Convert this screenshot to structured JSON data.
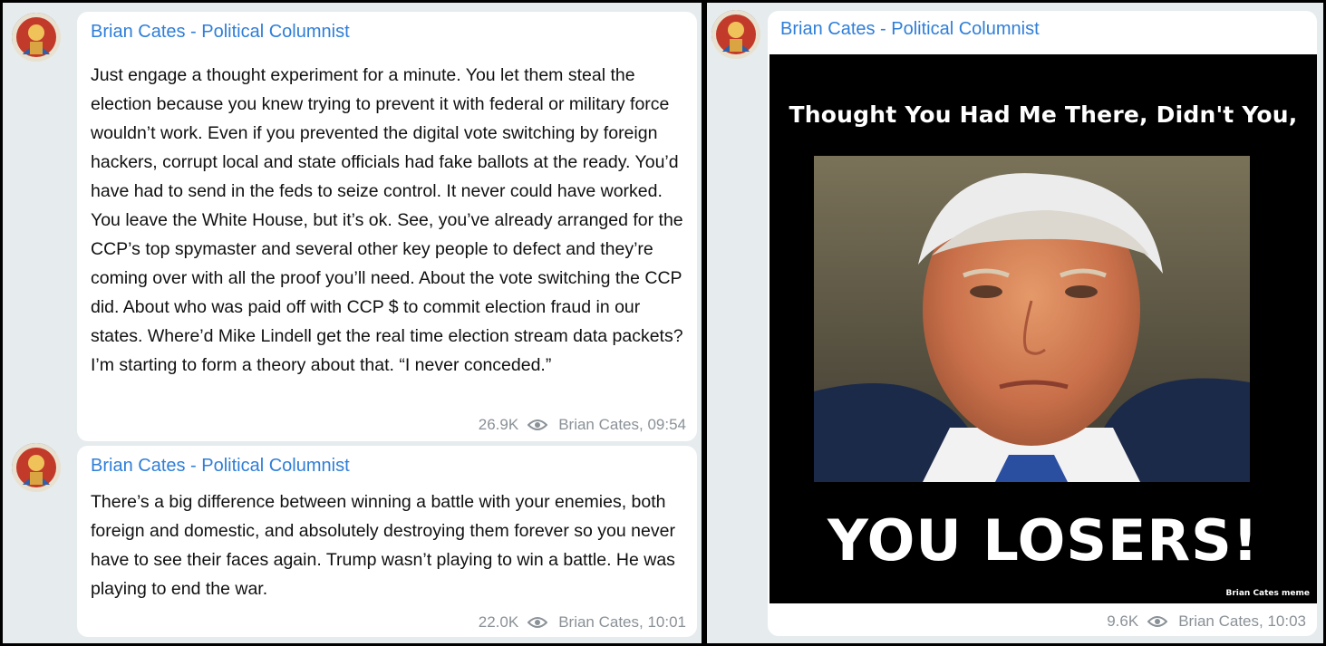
{
  "colors": {
    "author": "#2f7ed8",
    "panel_bg": "#e6ebee",
    "bubble_bg": "#ffffff",
    "meta": "#8a9197"
  },
  "icons": {
    "avatar": "avatar-icon",
    "views": "eye-icon"
  },
  "left_feed": {
    "posts": [
      {
        "author": "Brian Cates - Political Columnist",
        "text": "Just engage a thought experiment for a minute. You let them steal the election because you knew trying to prevent it with federal or military force wouldn’t work. Even if you prevented the digital vote switching by foreign hackers, corrupt local and state officials had fake ballots at the ready. You’d have had to send in the feds to seize control. It never could have worked. You leave the White House, but it’s ok. See, you’ve already arranged for the CCP’s top spymaster and several other key people to defect and they’re coming over with all the proof you’ll need. About the vote switching the CCP did. About who was paid off with CCP $ to commit election fraud in our states. Where’d Mike Lindell get the real time election stream data packets? I’m starting to form a theory about that. “I never conceded.”",
        "views": "26.9K",
        "signature": "Brian Cates, 09:54"
      },
      {
        "author": "Brian Cates - Political Columnist",
        "text": "There’s a big difference between winning a battle with your enemies, both foreign and domestic, and absolutely destroying them forever so you never have to see their faces again. Trump wasn’t playing to win a battle. He was playing to end the war.",
        "views": "22.0K",
        "signature": "Brian Cates, 10:01"
      }
    ]
  },
  "right_feed": {
    "post": {
      "author": "Brian Cates - Political Columnist",
      "meme": {
        "top_text": "Thought You Had Me There, Didn't You,",
        "bottom_text": "YOU LOSERS!",
        "credit": "Brian Cates meme"
      },
      "views": "9.6K",
      "signature": "Brian Cates, 10:03"
    }
  }
}
